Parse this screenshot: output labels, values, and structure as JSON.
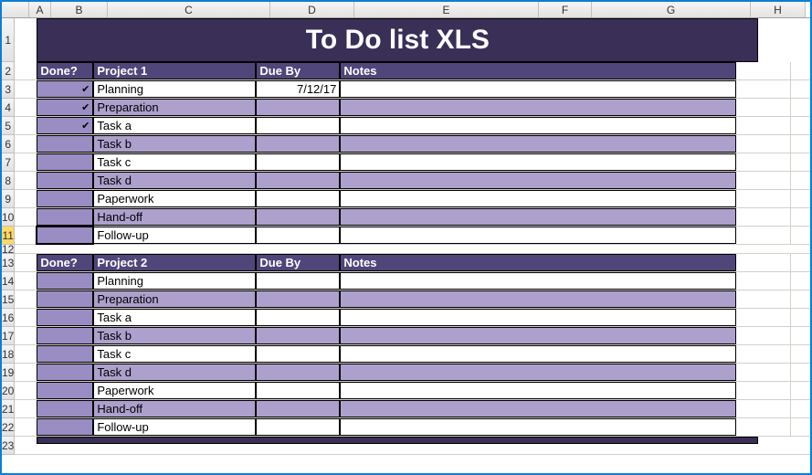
{
  "columns": [
    "A",
    "B",
    "C",
    "D",
    "E",
    "F",
    "G",
    "H"
  ],
  "title": "To Do list XLS",
  "selectedRow": 11,
  "projects": [
    {
      "headers": {
        "done": "Done?",
        "name": "Project 1",
        "due": "Due By",
        "notes": "Notes"
      },
      "tasks": [
        {
          "done": true,
          "name": "Planning",
          "due": "7/12/17",
          "notes": ""
        },
        {
          "done": true,
          "name": "Preparation",
          "due": "",
          "notes": ""
        },
        {
          "done": true,
          "name": "Task a",
          "due": "",
          "notes": ""
        },
        {
          "done": false,
          "name": "Task b",
          "due": "",
          "notes": ""
        },
        {
          "done": false,
          "name": "Task c",
          "due": "",
          "notes": ""
        },
        {
          "done": false,
          "name": "Task d",
          "due": "",
          "notes": ""
        },
        {
          "done": false,
          "name": "Paperwork",
          "due": "",
          "notes": ""
        },
        {
          "done": false,
          "name": "Hand-off",
          "due": "",
          "notes": ""
        },
        {
          "done": false,
          "name": "Follow-up",
          "due": "",
          "notes": ""
        }
      ]
    },
    {
      "headers": {
        "done": "Done?",
        "name": "Project 2",
        "due": "Due By",
        "notes": "Notes"
      },
      "tasks": [
        {
          "done": false,
          "name": "Planning",
          "due": "",
          "notes": ""
        },
        {
          "done": false,
          "name": "Preparation",
          "due": "",
          "notes": ""
        },
        {
          "done": false,
          "name": "Task a",
          "due": "",
          "notes": ""
        },
        {
          "done": false,
          "name": "Task b",
          "due": "",
          "notes": ""
        },
        {
          "done": false,
          "name": "Task c",
          "due": "",
          "notes": ""
        },
        {
          "done": false,
          "name": "Task d",
          "due": "",
          "notes": ""
        },
        {
          "done": false,
          "name": "Paperwork",
          "due": "",
          "notes": ""
        },
        {
          "done": false,
          "name": "Hand-off",
          "due": "",
          "notes": ""
        },
        {
          "done": false,
          "name": "Follow-up",
          "due": "",
          "notes": ""
        }
      ]
    }
  ]
}
